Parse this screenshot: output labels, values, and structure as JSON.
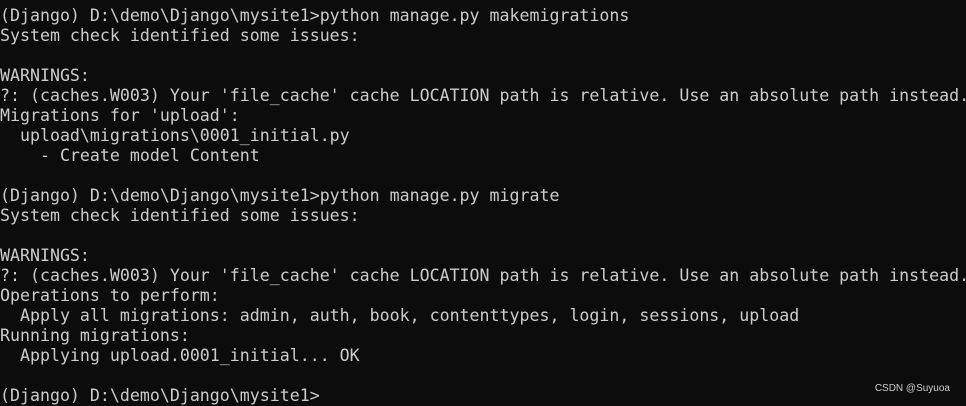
{
  "terminal": {
    "lines": [
      "(Django) D:\\demo\\Django\\mysite1>python manage.py makemigrations",
      "System check identified some issues:",
      "",
      "WARNINGS:",
      "?: (caches.W003) Your 'file_cache' cache LOCATION path is relative. Use an absolute path instead.",
      "Migrations for 'upload':",
      "  upload\\migrations\\0001_initial.py",
      "    - Create model Content",
      "",
      "(Django) D:\\demo\\Django\\mysite1>python manage.py migrate",
      "System check identified some issues:",
      "",
      "WARNINGS:",
      "?: (caches.W003) Your 'file_cache' cache LOCATION path is relative. Use an absolute path instead.",
      "Operations to perform:",
      "  Apply all migrations: admin, auth, book, contenttypes, login, sessions, upload",
      "Running migrations:",
      "  Applying upload.0001_initial... OK",
      "",
      "(Django) D:\\demo\\Django\\mysite1>"
    ]
  },
  "watermark": "CSDN @Suyuoa",
  "colors": {
    "background": "#0c0c0c",
    "text": "#cccccc"
  }
}
